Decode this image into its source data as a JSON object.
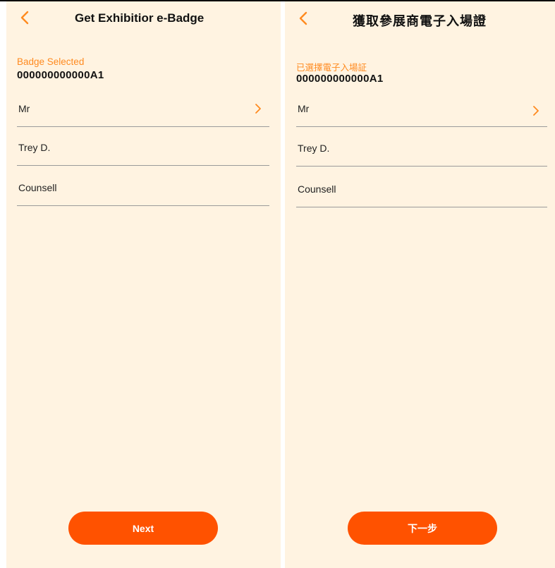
{
  "colors": {
    "accent": "#ff8a1f",
    "button": "#ff5200",
    "background": "#fff3e1"
  },
  "icons": {
    "back": "chevron-left-icon",
    "field_arrow": "chevron-right-icon"
  },
  "screens": {
    "english": {
      "title": "Get Exhibitior e-Badge",
      "badge_label": "Badge Selected",
      "badge_number": "000000000000A1",
      "fields": {
        "salutation": "Mr",
        "first_name": "Trey D.",
        "last_name": "Counsell"
      },
      "next_label": "Next"
    },
    "chinese": {
      "title": "獲取參展商電子入場證",
      "badge_label": "已選擇電子入場証",
      "badge_number": "000000000000A1",
      "fields": {
        "salutation": "Mr",
        "first_name": "Trey D.",
        "last_name": "Counsell"
      },
      "next_label": "下一步"
    }
  }
}
